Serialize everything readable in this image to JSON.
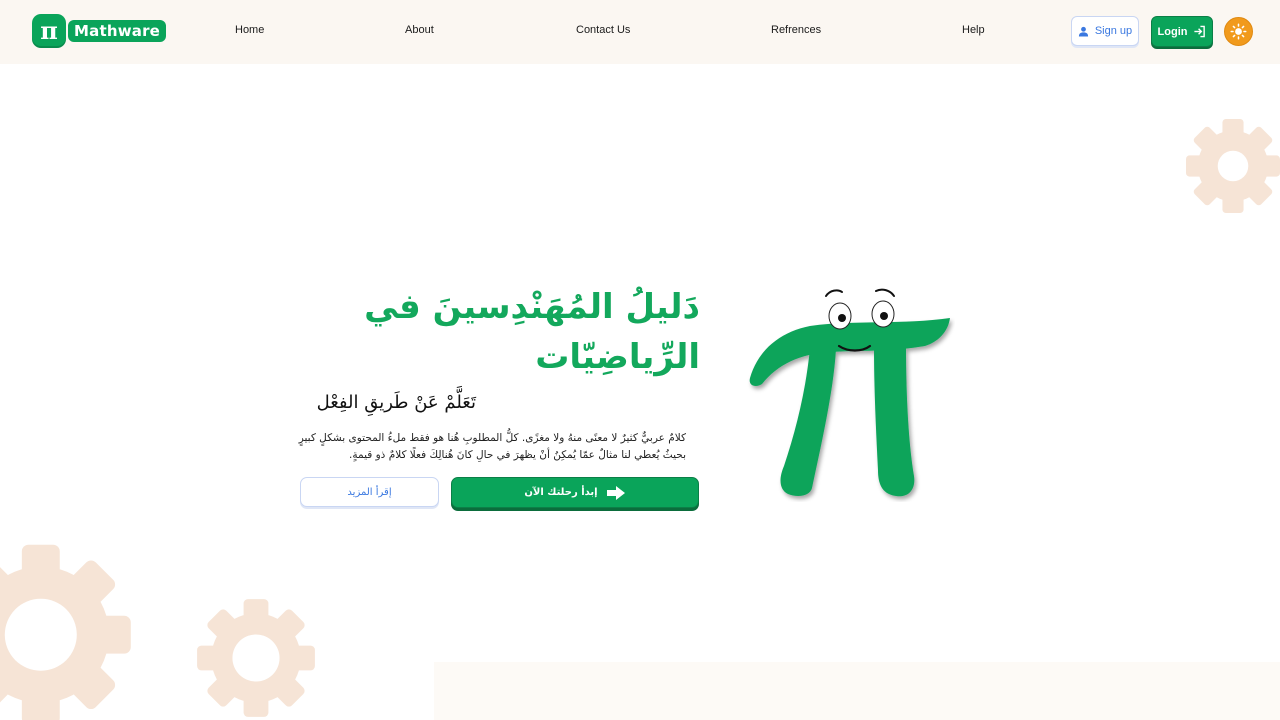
{
  "brand": {
    "name": "Mathware",
    "logo_glyph": "π",
    "accent": "#0aa45a"
  },
  "nav": {
    "links": [
      {
        "label": "Home"
      },
      {
        "label": "About"
      },
      {
        "label": "Contact Us"
      },
      {
        "label": "Refrences"
      },
      {
        "label": "Help"
      }
    ],
    "signup_label": "Sign up",
    "login_label": "Login",
    "theme_icon": "sun-icon"
  },
  "hero": {
    "title": "دَليلُ المُهَنْدِسينَ في الرِّياضِيّات",
    "subtitle": "تَعَلَّمْ عَنْ طَريقِ الفِعْل",
    "description": "كلامٌ عربيٌّ كثيرٌ لا معنًى منهُ ولا مغزًى. كلُّ المطلوبِ هُنا هو فقط ملءُ المحتوى بشكلٍ كبيرٍ بحيثُ يُعطي لنا مثالٌ عمّا يُمكِنُ أنْ يظهرَ في حالِ كانَ هُنالِكَ فعلًا كلامٌ ذو قيمةٍ.",
    "start_label": "إبدأ رحلتك الآن",
    "more_label": "إقرأ المزيد"
  },
  "colors": {
    "topbar": "#fbf7f2",
    "gear": "#f6e4d6",
    "primary": "#0aa45a",
    "link_blue": "#3a78e0",
    "sun": "#f19a1c"
  }
}
